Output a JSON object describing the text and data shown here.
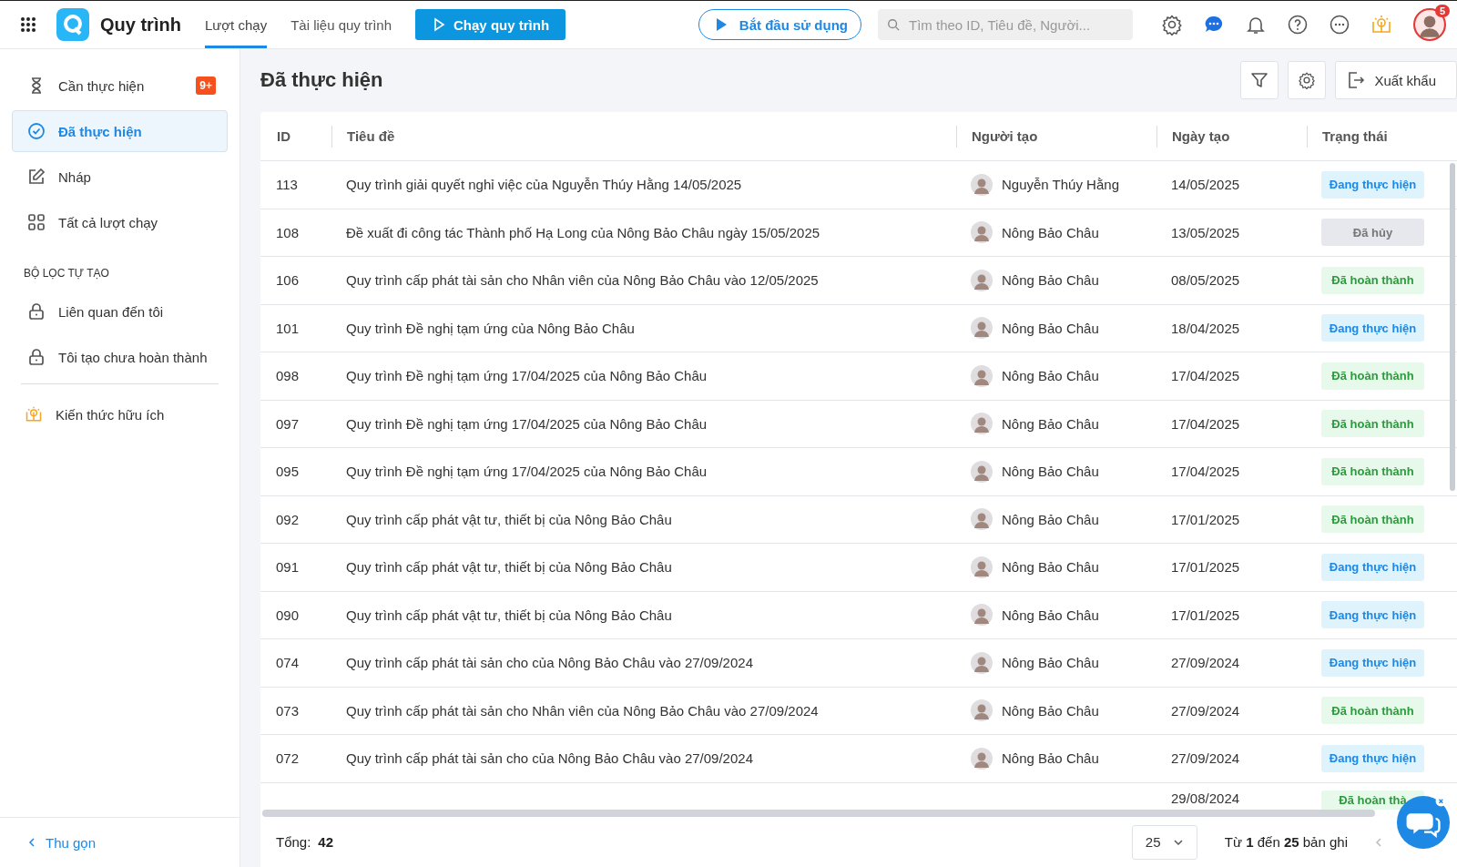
{
  "app": {
    "name": "Quy trình"
  },
  "nav_tabs": [
    {
      "label": "Lượt chạy",
      "selected": true
    },
    {
      "label": "Tài liệu quy trình",
      "selected": false
    }
  ],
  "run_button": "Chạy quy trình",
  "start_button": "Bắt đầu sử dụng",
  "search": {
    "placeholder": "Tìm theo ID, Tiêu đề, Người..."
  },
  "avatar_badge": "5",
  "sidebar": {
    "items": [
      {
        "label": "Cần thực hiện",
        "badge": "9+",
        "selected": false
      },
      {
        "label": "Đã thực hiện",
        "selected": true
      },
      {
        "label": "Nháp",
        "selected": false
      },
      {
        "label": "Tất cả lượt chạy",
        "selected": false
      }
    ],
    "section_title": "BỘ LỌC TỰ TẠO",
    "filters": [
      {
        "label": "Liên quan đến tôi",
        "selected": false
      },
      {
        "label": "Tôi tạo chưa hoàn thành",
        "selected": false
      }
    ],
    "knowledge": "Kiến thức hữu ích",
    "collapse": "Thu gọn"
  },
  "page_title": "Đã thực hiện",
  "export_button": "Xuất khẩu",
  "table": {
    "columns": [
      "ID",
      "Tiêu đề",
      "Người tạo",
      "Ngày tạo",
      "Trạng thái"
    ],
    "rows": [
      {
        "id": "113",
        "title": "Quy trình giải quyết nghỉ việc của Nguyễn Thúy Hằng 14/05/2025",
        "creator": "Nguyễn Thúy Hằng",
        "date": "14/05/2025",
        "status": {
          "label": "Đang thực hiện",
          "kind": "running"
        }
      },
      {
        "id": "108",
        "title": "Đề xuất đi công tác Thành phố Hạ Long của Nông Bảo Châu ngày 15/05/2025",
        "creator": "Nông Bảo Châu",
        "date": "13/05/2025",
        "status": {
          "label": "Đã hủy",
          "kind": "cancelled"
        }
      },
      {
        "id": "106",
        "title": "Quy trình cấp phát tài sản cho Nhân viên của Nông Bảo Châu vào 12/05/2025",
        "creator": "Nông Bảo Châu",
        "date": "08/05/2025",
        "status": {
          "label": "Đã hoàn thành",
          "kind": "done"
        }
      },
      {
        "id": "101",
        "title": "Quy trình Đề nghị tạm ứng của Nông Bảo Châu",
        "creator": "Nông Bảo Châu",
        "date": "18/04/2025",
        "status": {
          "label": "Đang thực hiện",
          "kind": "running"
        }
      },
      {
        "id": "098",
        "title": "Quy trình Đề nghị tạm ứng 17/04/2025 của Nông Bảo Châu",
        "creator": "Nông Bảo Châu",
        "date": "17/04/2025",
        "status": {
          "label": "Đã hoàn thành",
          "kind": "done"
        }
      },
      {
        "id": "097",
        "title": "Quy trình Đề nghị tạm ứng 17/04/2025 của Nông Bảo Châu",
        "creator": "Nông Bảo Châu",
        "date": "17/04/2025",
        "status": {
          "label": "Đã hoàn thành",
          "kind": "done"
        }
      },
      {
        "id": "095",
        "title": "Quy trình Đề nghị tạm ứng 17/04/2025 của Nông Bảo Châu",
        "creator": "Nông Bảo Châu",
        "date": "17/04/2025",
        "status": {
          "label": "Đã hoàn thành",
          "kind": "done"
        }
      },
      {
        "id": "092",
        "title": "Quy trình cấp phát vật tư, thiết bị của Nông Bảo Châu",
        "creator": "Nông Bảo Châu",
        "date": "17/01/2025",
        "status": {
          "label": "Đã hoàn thành",
          "kind": "done"
        }
      },
      {
        "id": "091",
        "title": "Quy trình cấp phát vật tư, thiết bị của Nông Bảo Châu",
        "creator": "Nông Bảo Châu",
        "date": "17/01/2025",
        "status": {
          "label": "Đang thực hiện",
          "kind": "running"
        }
      },
      {
        "id": "090",
        "title": "Quy trình cấp phát vật tư, thiết bị của Nông Bảo Châu",
        "creator": "Nông Bảo Châu",
        "date": "17/01/2025",
        "status": {
          "label": "Đang thực hiện",
          "kind": "running"
        }
      },
      {
        "id": "074",
        "title": "Quy trình cấp phát tài sản cho của Nông Bảo Châu vào 27/09/2024",
        "creator": "Nông Bảo Châu",
        "date": "27/09/2024",
        "status": {
          "label": "Đang thực hiện",
          "kind": "running"
        }
      },
      {
        "id": "073",
        "title": "Quy trình cấp phát tài sản cho Nhân viên của Nông Bảo Châu vào 27/09/2024",
        "creator": "Nông Bảo Châu",
        "date": "27/09/2024",
        "status": {
          "label": "Đã hoàn thành",
          "kind": "done"
        }
      },
      {
        "id": "072",
        "title": "Quy trình cấp phát tài sản cho của Nông Bảo Châu vào 27/09/2024",
        "creator": "Nông Bảo Châu",
        "date": "27/09/2024",
        "status": {
          "label": "Đang thực hiện",
          "kind": "running"
        }
      }
    ],
    "partial_row": {
      "date": "29/08/2024",
      "status": {
        "label": "Đã hoàn thà",
        "kind": "done"
      }
    }
  },
  "footer": {
    "total_label": "Tổng:",
    "total": "42",
    "page_size": "25",
    "range": "Từ **1** đến **25** bản ghi"
  }
}
